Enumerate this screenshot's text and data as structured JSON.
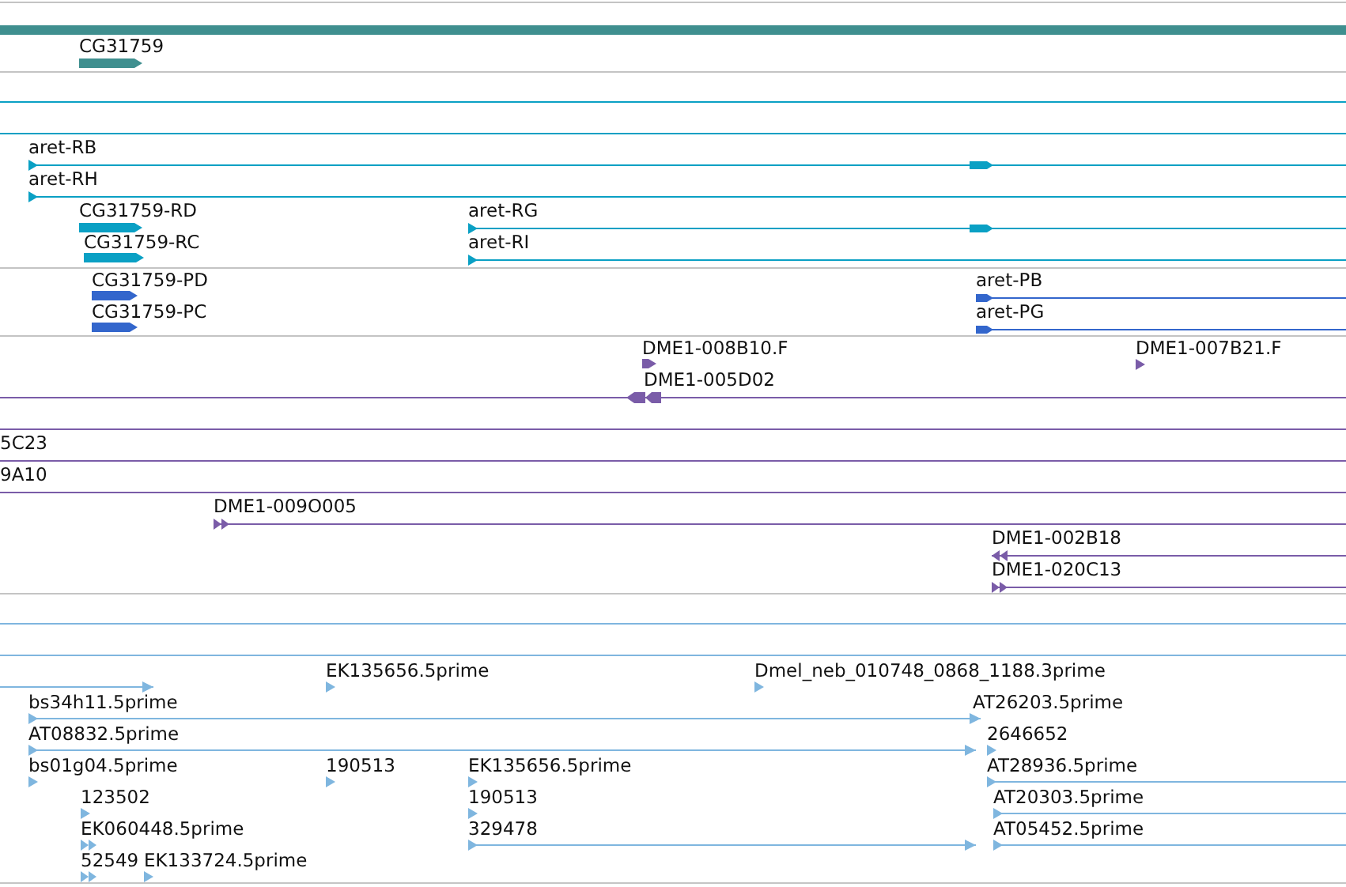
{
  "tracks": [
    {
      "color": "#3f8f8f",
      "features": [
        {
          "label": "CG31759"
        }
      ]
    },
    {
      "color": "#0aa0c4",
      "features": [
        {
          "label": "aret-RB"
        },
        {
          "label": "aret-RH"
        },
        {
          "label": "CG31759-RD"
        },
        {
          "label": "aret-RG"
        },
        {
          "label": "CG31759-RC"
        },
        {
          "label": "aret-RI"
        }
      ]
    },
    {
      "color": "#3366cc",
      "features": [
        {
          "label": "CG31759-PD"
        },
        {
          "label": "aret-PB"
        },
        {
          "label": "CG31759-PC"
        },
        {
          "label": "aret-PG"
        }
      ]
    },
    {
      "color": "#7a5ca8",
      "features": [
        {
          "label": "DME1-008B10.F"
        },
        {
          "label": "DME1-007B21.F"
        },
        {
          "label": "DME1-005D02"
        },
        {
          "label": "5C23"
        },
        {
          "label": "9A10"
        },
        {
          "label": "DME1-009O005"
        },
        {
          "label": "DME1-002B18"
        },
        {
          "label": "DME1-020C13"
        }
      ]
    },
    {
      "color": "#7fb6df",
      "features": [
        {
          "label": "EK135656.5prime"
        },
        {
          "label": "Dmel_neb_010748_0868_1188.3prime"
        },
        {
          "label": "bs34h11.5prime"
        },
        {
          "label": "AT26203.5prime"
        },
        {
          "label": "AT08832.5prime"
        },
        {
          "label": "2646652"
        },
        {
          "label": "bs01g04.5prime"
        },
        {
          "label": "190513"
        },
        {
          "label": "EK135656.5prime"
        },
        {
          "label": "AT28936.5prime"
        },
        {
          "label": "123502"
        },
        {
          "label": "190513"
        },
        {
          "label": "AT20303.5prime"
        },
        {
          "label": "EK060448.5prime"
        },
        {
          "label": "329478"
        },
        {
          "label": "AT05452.5prime"
        },
        {
          "label": "52549"
        },
        {
          "label": "EK133724.5prime"
        }
      ]
    }
  ]
}
